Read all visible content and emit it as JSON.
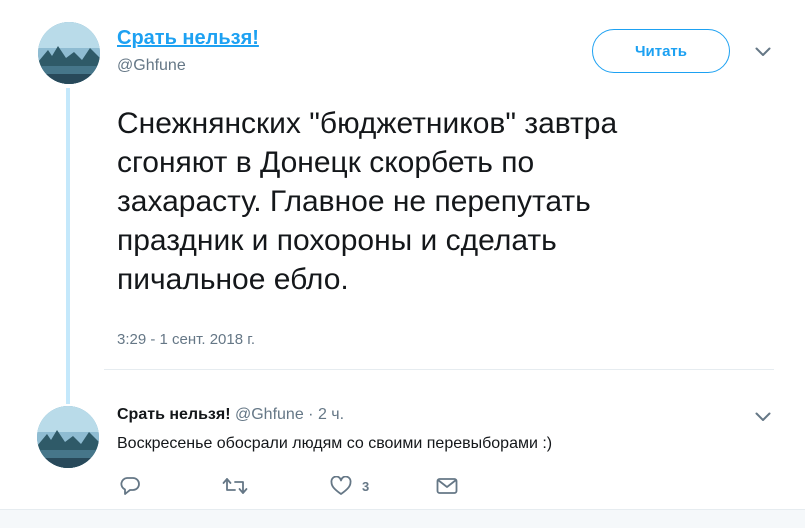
{
  "main_tweet": {
    "author_name": "Срать нельзя!",
    "author_handle": "@Ghfune",
    "follow_label": "Читать",
    "text_lines": [
      "Снежнянских \"бюджетников\" завтра",
      "сгоняют в Донецк скорбеть по",
      "захарасту. Главное не перепутать",
      "праздник и похороны и сделать",
      "пичальное ебло."
    ],
    "timestamp": "3:29 - 1 сент. 2018 г."
  },
  "reply": {
    "author_name": "Срать нельзя!",
    "author_handle": "@Ghfune",
    "separator": "·",
    "time": "2 ч.",
    "text": "Воскресенье обосрали людям со своими перевыборами :)",
    "actions": {
      "like_count": "3"
    }
  },
  "colors": {
    "accent": "#1da1f2",
    "muted": "#657786",
    "thread_line": "#c4e8fb"
  },
  "icons": [
    "chevron-down-icon",
    "reply-icon",
    "retweet-icon",
    "like-icon",
    "direct-message-icon"
  ]
}
